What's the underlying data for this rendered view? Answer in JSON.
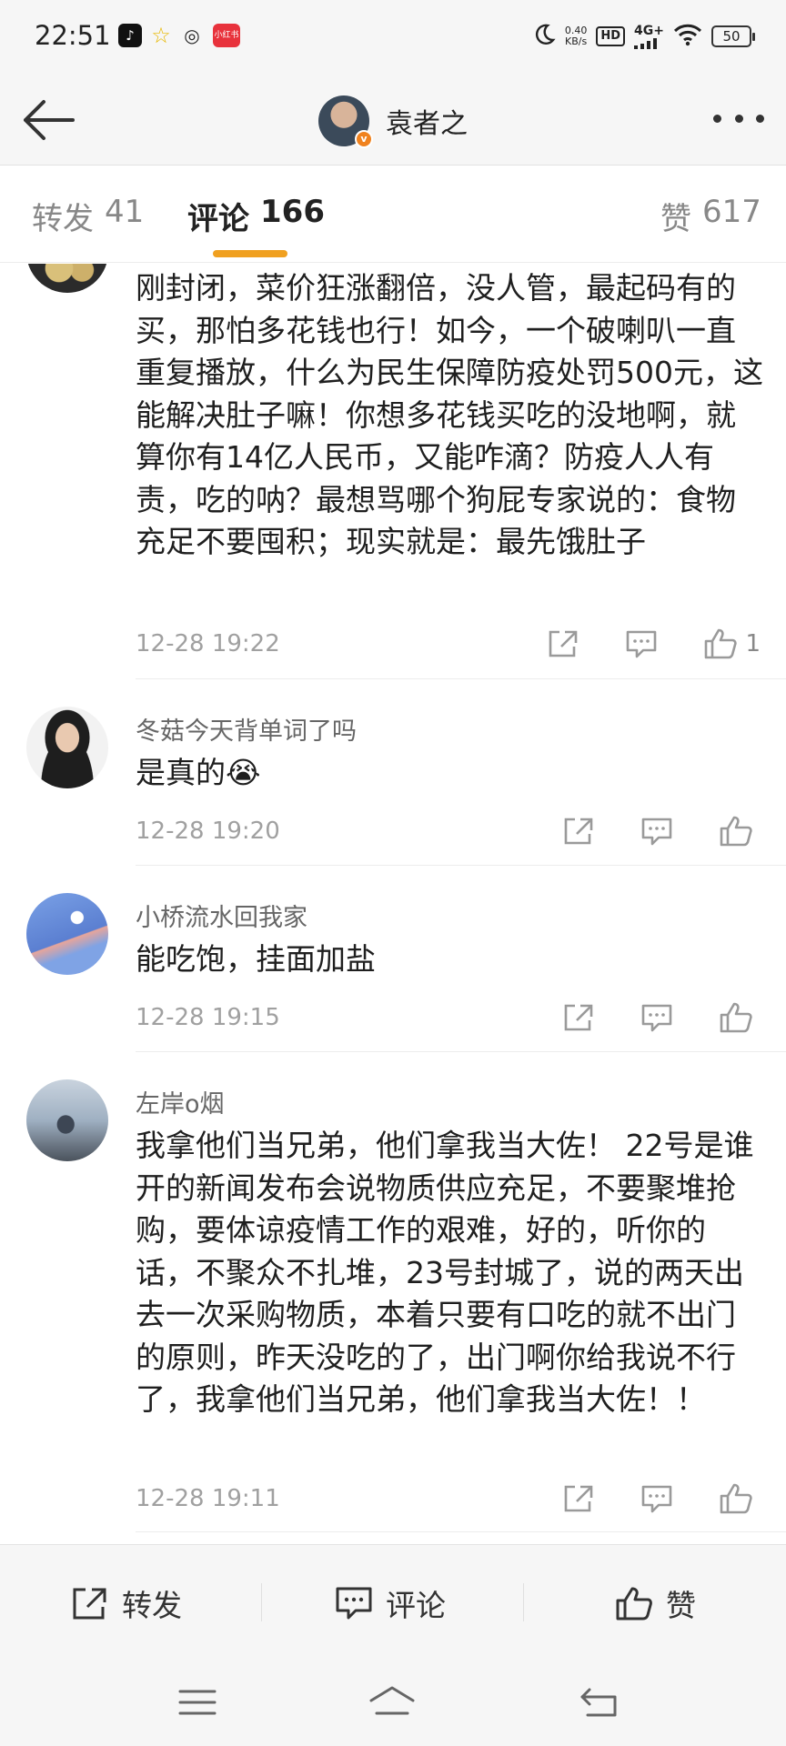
{
  "status_bar": {
    "time": "22:51",
    "apps": [
      "tiktok-icon",
      "star-icon",
      "weibo-icon",
      "red-app-icon"
    ],
    "red_app_label": "小红书",
    "net_speed_value": "0.40",
    "net_speed_unit": "KB/s",
    "hd": "HD",
    "network": "4G+",
    "battery": "50"
  },
  "nav": {
    "title": "袁者之"
  },
  "tabs": {
    "repost": {
      "label": "转发",
      "count": "41"
    },
    "comment": {
      "label": "评论",
      "count": "166"
    },
    "like": {
      "label": "赞",
      "count": "617"
    }
  },
  "comments": [
    {
      "user": "",
      "text": "刚封闭，菜价狂涨翻倍，没人管，最起码有的买，那怕多花钱也行！如今，一个破喇叭一直重复播放，什么为民生保障防疫处罚500元，这能解决肚子嘛！你想多花钱买吃的没地啊，就算你有14亿人民币，又能咋滴？防疫人人有责，吃的呐？最想骂哪个狗屁专家说的：食物充足不要囤积；现实就是：最先饿肚子",
      "time": "12-28 19:22",
      "likes": "1"
    },
    {
      "user": "冬菇今天背单词了吗",
      "text": "是真的😭",
      "time": "12-28 19:20",
      "likes": ""
    },
    {
      "user": "小桥流水回我家",
      "text": "能吃饱，挂面加盐",
      "time": "12-28 19:15",
      "likes": ""
    },
    {
      "user": "左岸o烟",
      "text": "我拿他们当兄弟，他们拿我当大佐！ 22号是谁开的新闻发布会说物质供应充足，不要聚堆抢购，要体谅疫情工作的艰难，好的，听你的话，不聚众不扎堆，23号封城了，说的两天出去一次采购物质，本着只要有口吃的就不出门的原则，昨天没吃的了，出门啊你给我说不行了，我拿他们当兄弟，他们拿我当大佐！！",
      "time": "12-28 19:11",
      "likes": ""
    }
  ],
  "bottom_bar": {
    "repost": "转发",
    "comment": "评论",
    "like": "赞"
  },
  "colors": {
    "accent_tab_underline": "#f0a020",
    "verified_badge": "#f0821e",
    "bars_background": "#f6f6f6"
  }
}
